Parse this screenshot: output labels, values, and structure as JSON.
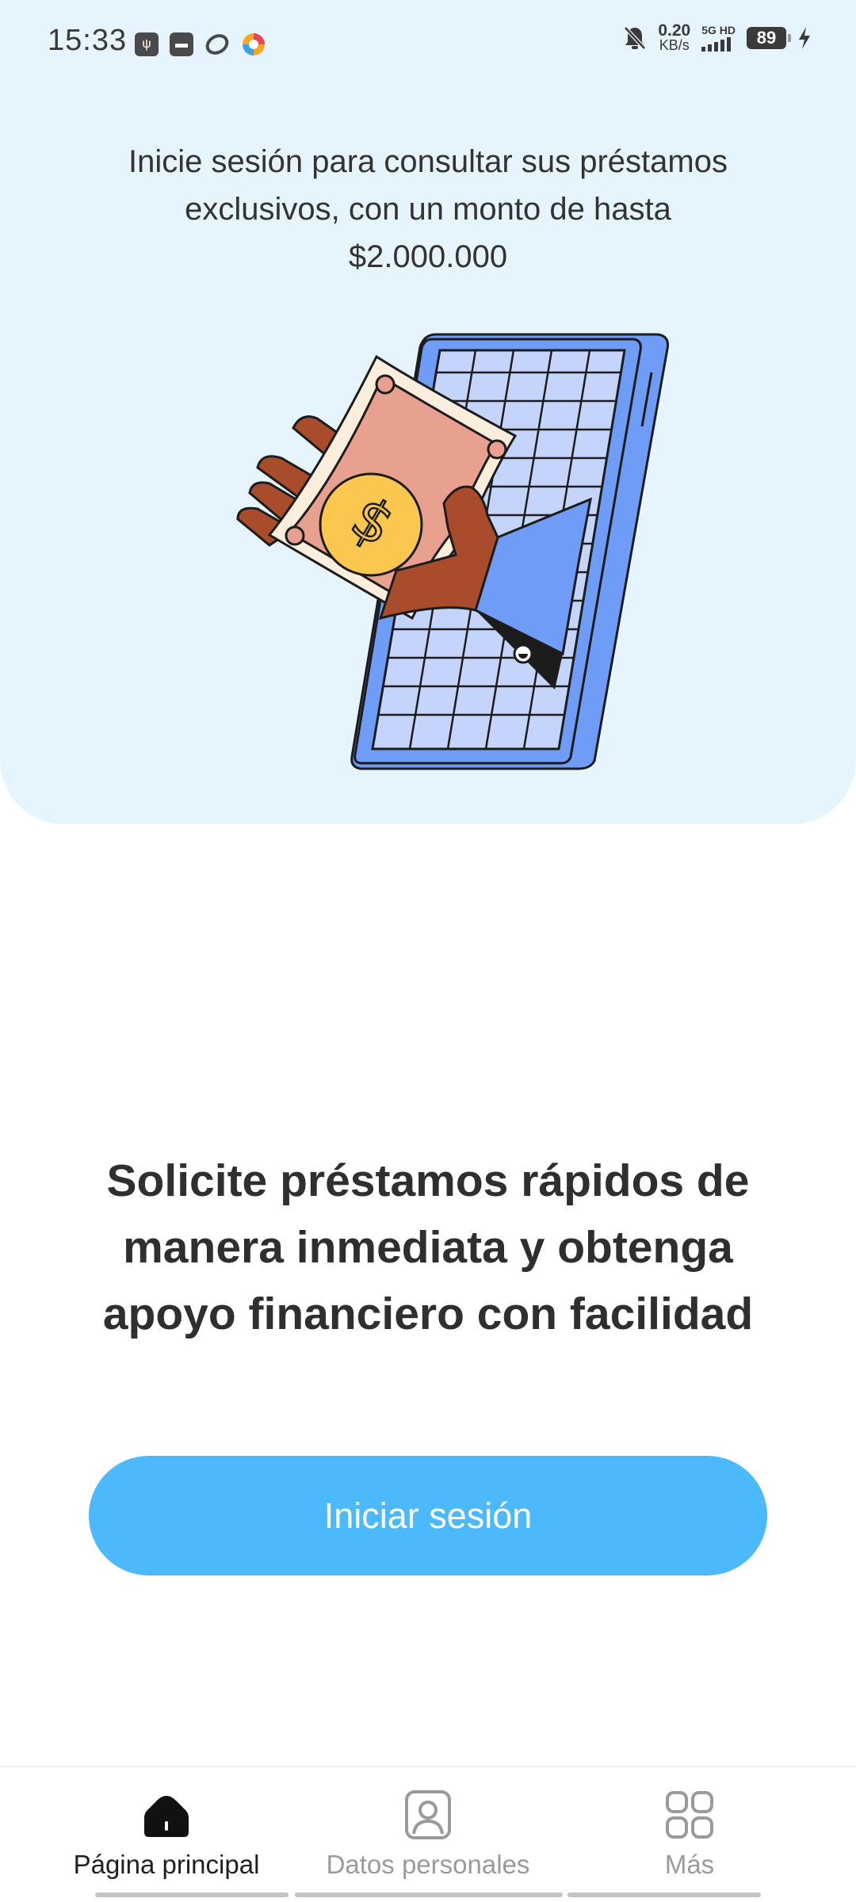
{
  "status_bar": {
    "time": "15:33",
    "net_speed_value": "0.20",
    "net_speed_unit": "KB/s",
    "signal_label": "5G HD",
    "battery": "89"
  },
  "hero": {
    "text": "Inicie sesión para consultar sus préstamos exclusivos, con un monto de hasta $2.000.000"
  },
  "headline": "Solicite préstamos rápidos de manera inmediata y obtenga apoyo financiero con facilidad",
  "login_button": "Iniciar sesión",
  "bottom_nav": {
    "items": [
      {
        "label": "Página principal",
        "icon": "home-icon",
        "active": true
      },
      {
        "label": "Datos personales",
        "icon": "person-icon",
        "active": false
      },
      {
        "label": "Más",
        "icon": "grid-icon",
        "active": false
      }
    ]
  },
  "colors": {
    "hero_bg": "#e6f5fd",
    "accent": "#4bb9fb",
    "phone": "#6f9cf6",
    "bill": "#e8a08f",
    "coin": "#fbc74f"
  }
}
